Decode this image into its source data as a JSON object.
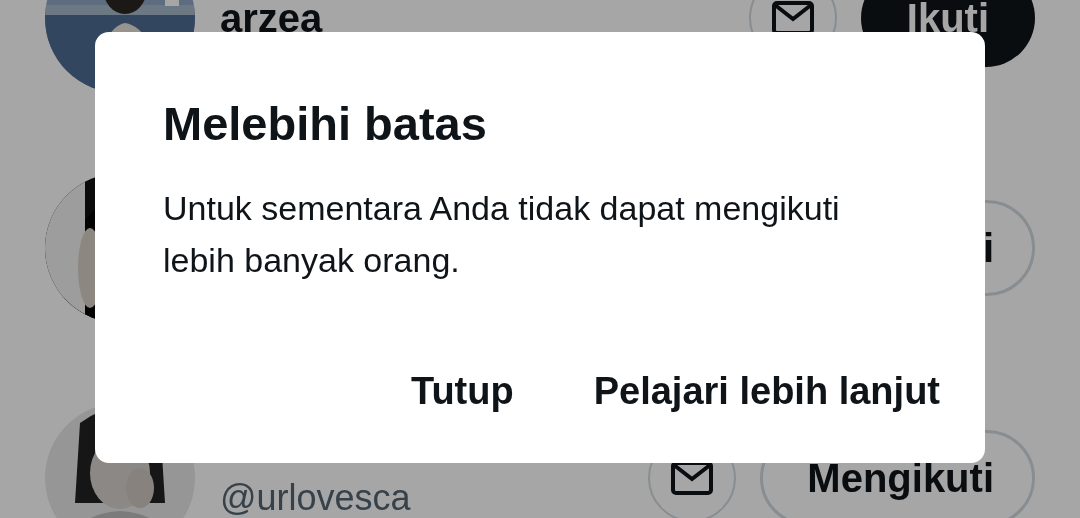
{
  "users": [
    {
      "name": "arzea",
      "message_button": true,
      "follow_button": {
        "label": "Ikuti",
        "kind": "follow"
      }
    },
    {
      "message_button": false,
      "follow_button": {
        "label": "i",
        "kind": "following"
      }
    },
    {
      "handle": "@urlovesca",
      "message_button": true,
      "follow_button": {
        "label": "Mengikuti",
        "kind": "following"
      }
    }
  ],
  "dialog": {
    "title": "Melebihi batas",
    "message": "Untuk sementara Anda tidak dapat mengikuti lebih banyak orang.",
    "buttons": [
      "Tutup",
      "Pelajari lebih lanjut"
    ]
  }
}
